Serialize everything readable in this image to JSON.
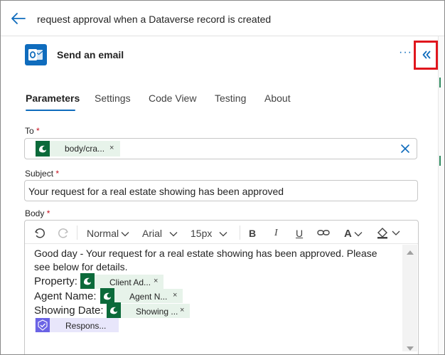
{
  "header": {
    "flow_title": "request approval when a Dataverse record is created"
  },
  "action": {
    "title": "Send an email",
    "more_label": "···",
    "collapse_label": "«"
  },
  "tabs": [
    {
      "label": "Parameters",
      "active": true
    },
    {
      "label": "Settings",
      "active": false
    },
    {
      "label": "Code View",
      "active": false
    },
    {
      "label": "Testing",
      "active": false
    },
    {
      "label": "About",
      "active": false
    }
  ],
  "fields": {
    "to": {
      "label": "To",
      "required_mark": "*",
      "token": "body/cra...",
      "token_remove": "×"
    },
    "subject": {
      "label": "Subject",
      "required_mark": "*",
      "value": "Your request for a real estate showing has been approved"
    },
    "body": {
      "label": "Body",
      "required_mark": "*",
      "toolbar": {
        "style": "Normal",
        "font": "Arial",
        "size": "15px",
        "bold": "B",
        "italic": "I",
        "underline": "U",
        "font_color": "A"
      },
      "line1": "Good day - Your request for a real estate showing has been approved. Please",
      "line2": "see below for details.",
      "property_label": "Property:",
      "property_token": "Client Ad...",
      "agent_label": "Agent Name:",
      "agent_token": "Agent N...",
      "showing_label": "Showing Date:",
      "showing_token": "Showing ...",
      "response_token": "Respons...",
      "token_remove": "×"
    }
  },
  "colors": {
    "accent": "#0f6cbd",
    "dataverse": "#0b6a3a",
    "token_bg": "#e7f3ea",
    "ai_token_bg": "#e8e6fb",
    "highlight_box": "#e0161d",
    "required": "#c50f1f"
  },
  "icons": {
    "back": "back-arrow-icon",
    "outlook": "outlook-icon",
    "dataverse": "dataverse-icon",
    "approvals": "approvals-icon"
  }
}
